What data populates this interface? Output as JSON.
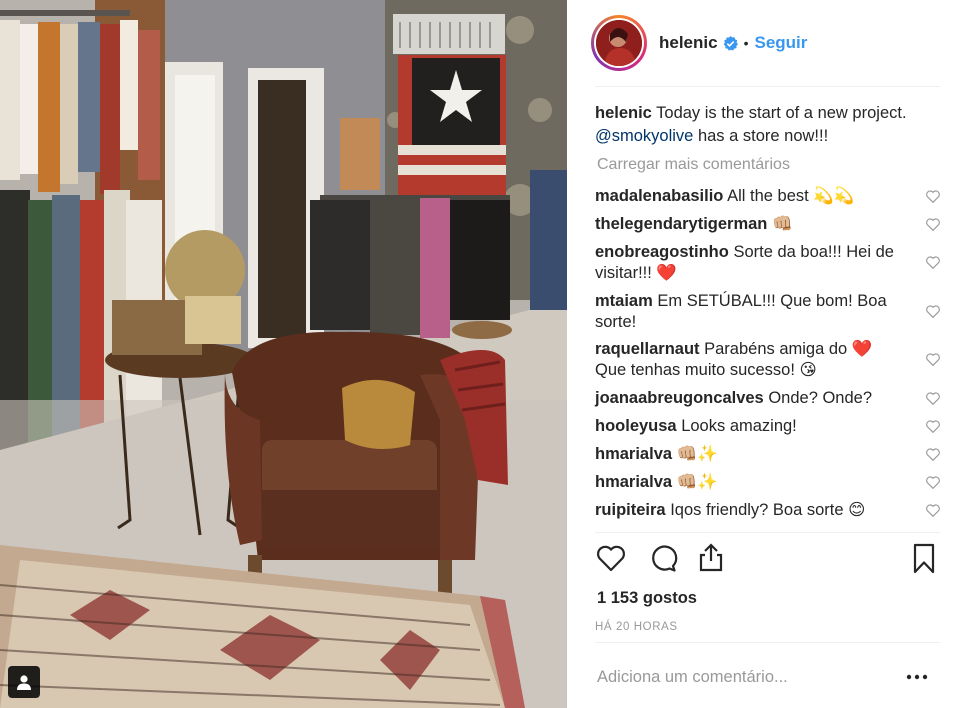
{
  "post": {
    "username": "helenic",
    "follow_label": "Seguir",
    "separator": "•",
    "caption_text": "Today is the start of a new project.",
    "caption_mention": "@smokyolive",
    "caption_rest": "has a store now!!!",
    "load_more_label": "Carregar mais comentários",
    "likes_label": "1 153 gostos",
    "time_label": "HÁ 20 HORAS",
    "add_comment_placeholder": "Adiciona um comentário...",
    "more_label": "..."
  },
  "comments": [
    {
      "user": "madalenabasilio",
      "text": "All the best 💫💫"
    },
    {
      "user": "thelegendarytigerman",
      "text": "👊🏼"
    },
    {
      "user": "enobreagostinho",
      "text": "Sorte da boa!!! Hei de visitar!!! ❤️"
    },
    {
      "user": "mtaiam",
      "text": "Em SETÚBAL!!! Que bom! Boa sorte!"
    },
    {
      "user": "raquellarnaut",
      "text": "Parabéns amiga do ❤️ Que tenhas muito sucesso! 😘"
    },
    {
      "user": "joanaabreugoncalves",
      "text": "Onde? Onde?"
    },
    {
      "user": "hooleyusa",
      "text": "Looks amazing!"
    },
    {
      "user": "hmarialva",
      "text": "👊🏼✨"
    },
    {
      "user": "hmarialva",
      "text": "👊🏼✨"
    },
    {
      "user": "ruipiteira",
      "text": "Iqos friendly? Boa sorte 😊"
    }
  ],
  "icons": {
    "verified": "verified-badge-icon",
    "like": "heart-icon",
    "comment": "comment-bubble-icon",
    "share": "share-icon",
    "save": "bookmark-icon",
    "user_tag": "user-tag-icon",
    "comment_like": "heart-outline-icon"
  },
  "colors": {
    "link_blue": "#3897f0",
    "mention_blue": "#003569",
    "muted_gray": "#999999",
    "text_dark": "#262626"
  }
}
